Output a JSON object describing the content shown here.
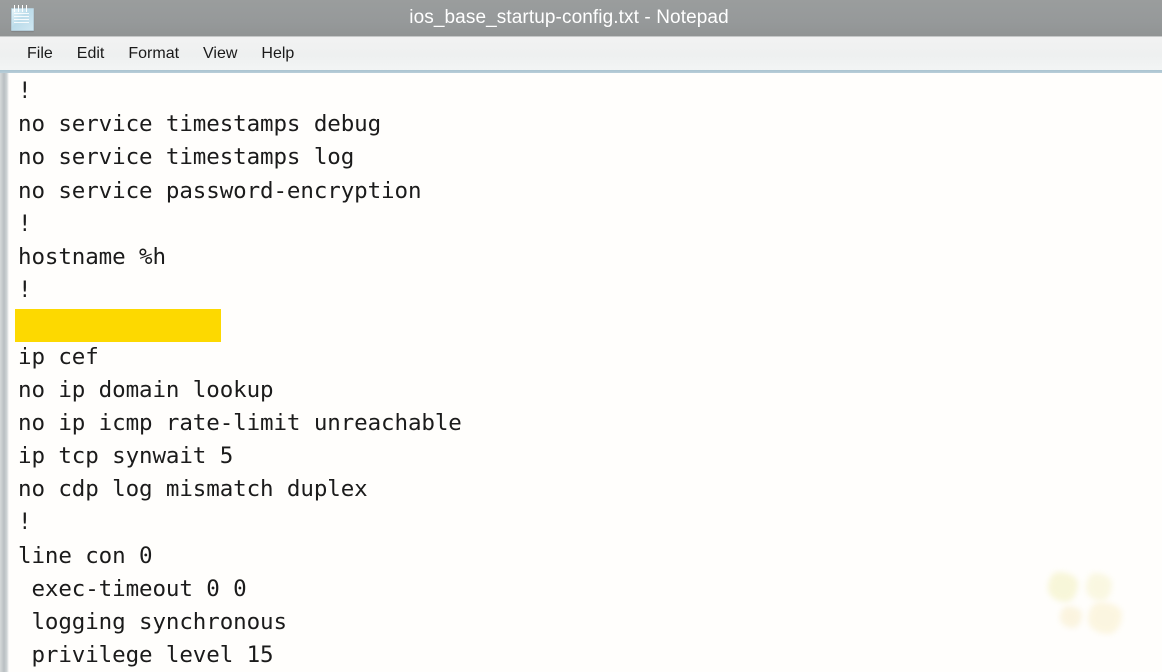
{
  "window": {
    "title": "ios_base_startup-config.txt - Notepad",
    "app_icon": "notepad-icon"
  },
  "menubar": {
    "items": [
      {
        "label": "File"
      },
      {
        "label": "Edit"
      },
      {
        "label": "Format"
      },
      {
        "label": "View"
      },
      {
        "label": "Help"
      }
    ]
  },
  "editor": {
    "lines": [
      {
        "text": "!",
        "redacted": false
      },
      {
        "text": "no service timestamps debug",
        "redacted": false
      },
      {
        "text": "no service timestamps log",
        "redacted": false
      },
      {
        "text": "no service password-encryption",
        "redacted": false
      },
      {
        "text": "!",
        "redacted": false
      },
      {
        "text": "hostname %h",
        "redacted": false
      },
      {
        "text": "!",
        "redacted": false
      },
      {
        "text": "",
        "redacted": true
      },
      {
        "text": "ip cef",
        "redacted": false
      },
      {
        "text": "no ip domain lookup",
        "redacted": false
      },
      {
        "text": "no ip icmp rate-limit unreachable",
        "redacted": false
      },
      {
        "text": "ip tcp synwait 5",
        "redacted": false
      },
      {
        "text": "no cdp log mismatch duplex",
        "redacted": false
      },
      {
        "text": "!",
        "redacted": false
      },
      {
        "text": "line con 0",
        "redacted": false
      },
      {
        "text": " exec-timeout 0 0",
        "redacted": false
      },
      {
        "text": " logging synchronous",
        "redacted": false
      },
      {
        "text": " privilege level 15",
        "redacted": false
      }
    ]
  },
  "colors": {
    "titlebar_bg": "#979a9a",
    "titlebar_text": "#ffffff",
    "menubar_bg": "#f0f2f2",
    "menubar_rule": "#a9c3d0",
    "editor_bg": "#fffefc",
    "editor_text": "#1b1b1b",
    "redaction_highlight": "#fdd900"
  },
  "watermark": {
    "name": "blob-watermark"
  }
}
